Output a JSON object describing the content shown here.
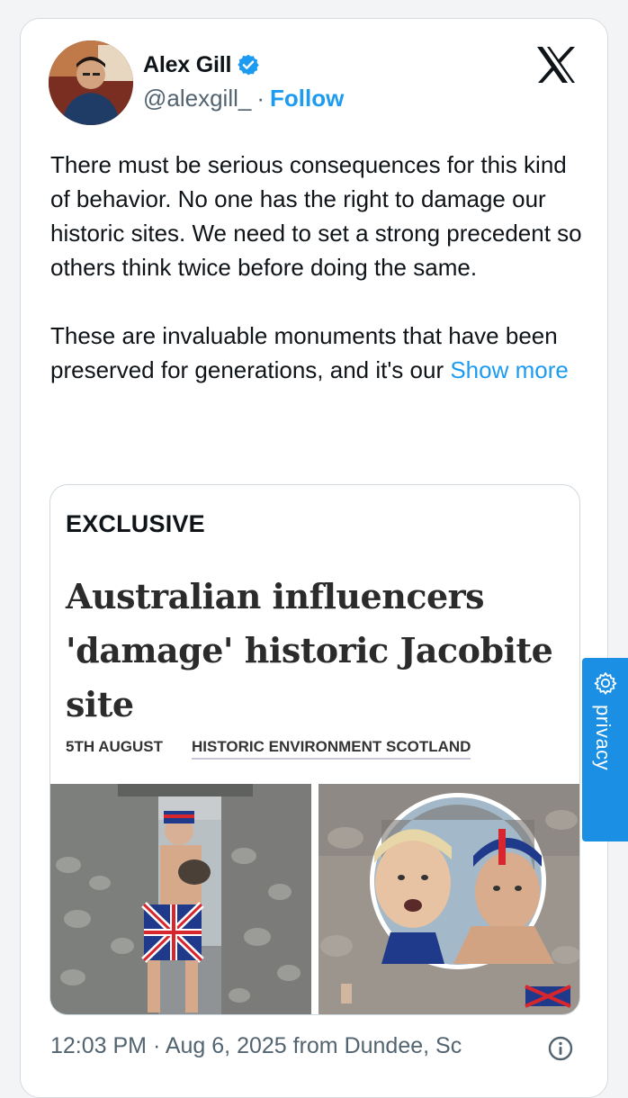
{
  "user": {
    "name": "Alex Gill",
    "handle": "@alexgill_",
    "separator": "·",
    "follow_label": "Follow"
  },
  "icons": {
    "verified": "verified-badge-icon",
    "brand": "x-logo-icon",
    "info": "info-icon",
    "privacy": "gear-icon"
  },
  "tweet": {
    "paragraph1": "There must be serious consequences for this kind of behavior. No one has the right to damage our historic sites. We need to set a strong precedent so others think twice before doing the same.",
    "paragraph2_text": "These are invaluable monuments that have been preserved for generations, and it's our",
    "show_more": "Show more",
    "timestamp": "12:03 PM · Aug 6, 2025 from Dundee, Sc"
  },
  "article": {
    "label": "EXCLUSIVE",
    "headline": "Australian influencers 'damage' historic Jacobite site",
    "date": "5TH AUGUST",
    "source": "HISTORIC ENVIRONMENT SCOTLAND"
  },
  "privacy": {
    "label": "privacy"
  },
  "colors": {
    "link": "#1d9bf0",
    "privacy_tab": "#1a8fe3",
    "secondary_text": "#536471"
  }
}
